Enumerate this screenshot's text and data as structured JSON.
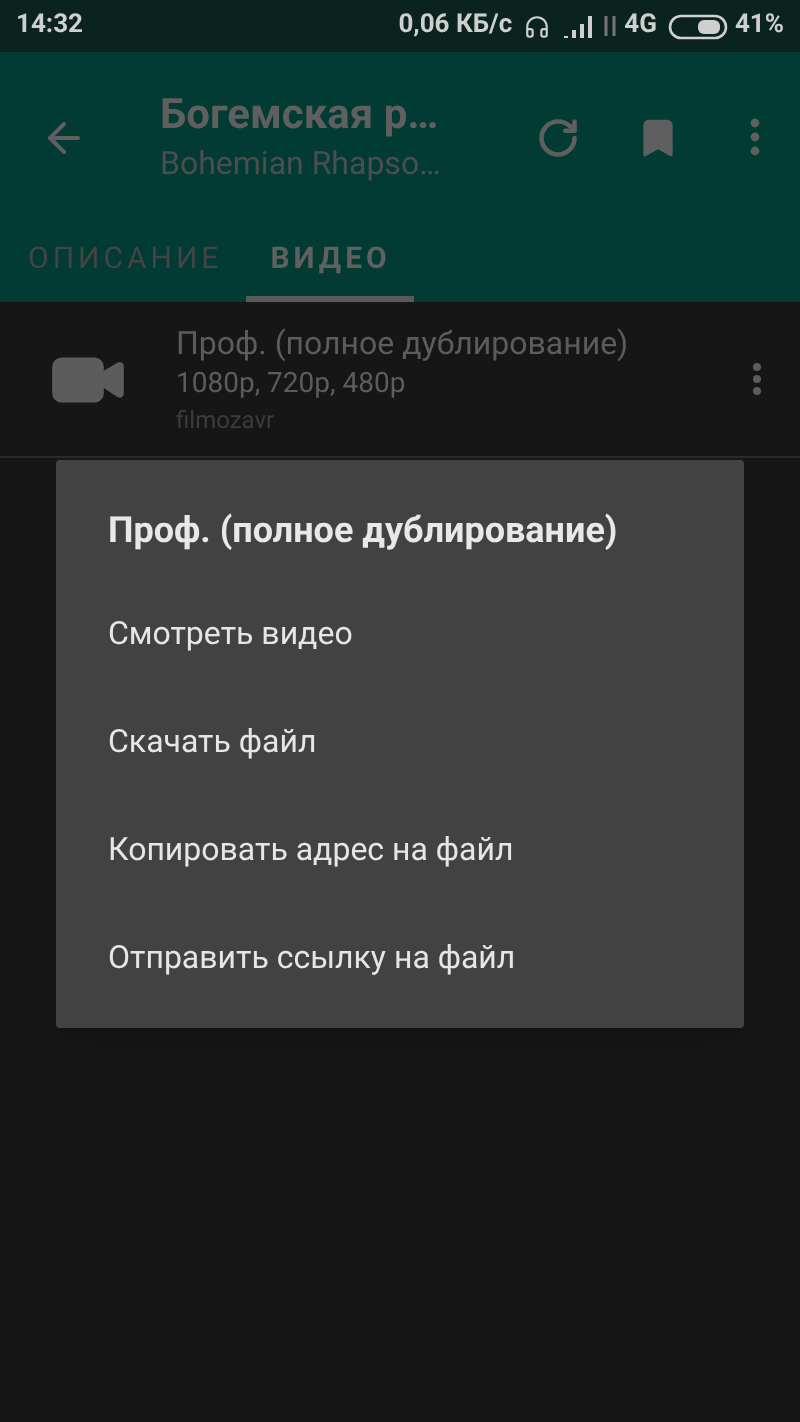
{
  "status_bar": {
    "time": "14:32",
    "speed": "0,06 КБ/с",
    "network": "4G",
    "battery": "41%"
  },
  "toolbar": {
    "title": "Богемская р…",
    "subtitle": "Bohemian Rhapso…"
  },
  "tabs": [
    {
      "label": "ОПИСАНИЕ",
      "selected": false
    },
    {
      "label": "ВИДЕО",
      "selected": true
    }
  ],
  "items": [
    {
      "title": "Проф. (полное дублирование)",
      "qualities": "1080p, 720p, 480p",
      "source": "filmozavr"
    }
  ],
  "dialog": {
    "title": "Проф. (полное дублирование)",
    "options": [
      "Смотреть видео",
      "Скачать файл",
      "Копировать адрес на файл",
      "Отправить ссылку на файл"
    ]
  }
}
